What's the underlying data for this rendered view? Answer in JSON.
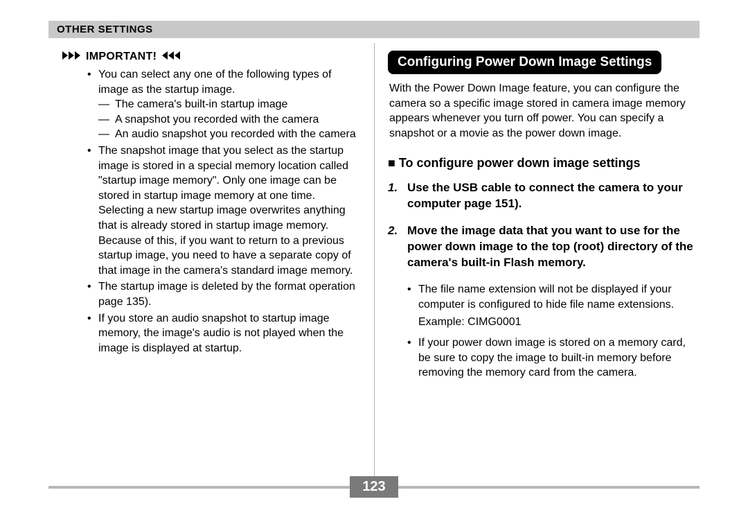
{
  "header": "Other Settings",
  "important": {
    "label": "IMPORTANT!",
    "bullets": [
      {
        "text": "You can select any one of the following types of image as the startup image.",
        "sub": [
          "The camera's built-in startup image",
          "A snapshot you recorded with the camera",
          "An audio snapshot you recorded with the camera"
        ]
      },
      {
        "text": "The snapshot image that you select as the startup image is stored in a special memory location called \"startup image memory\". Only one image can be stored in startup image memory at one time. Selecting a new startup image overwrites anything that is already stored in startup image memory. Because of this, if you want to return to a previous startup image, you need to have a separate copy of that image in the camera's standard image memory."
      },
      {
        "text": "The startup image is deleted by the format operation page 135)."
      },
      {
        "text": "If you store an audio snapshot to startup image memory, the image's audio is not played when the image is displayed at startup."
      }
    ]
  },
  "right": {
    "title": "Configuring Power Down Image Settings",
    "intro": "With the Power Down Image feature, you can configure the camera so a specific image stored in camera image memory appears whenever you turn off power. You can specify a snapshot or a movie as the power down image.",
    "subheading": "■ To configure power down image settings",
    "steps": [
      "Use the USB cable to connect the camera to your computer page 151).",
      "Move the image data that you want to use for the power down image to the top (root) directory of the camera's built-in Flash memory."
    ],
    "substep_bullets": [
      "The file name extension will not be displayed if your computer is configured to hide file name extensions.",
      "If your power down image is stored on a memory card, be sure to copy the image to built-in memory before removing the memory card from the camera."
    ],
    "example": "Example: CIMG0001"
  },
  "page_number": "123"
}
